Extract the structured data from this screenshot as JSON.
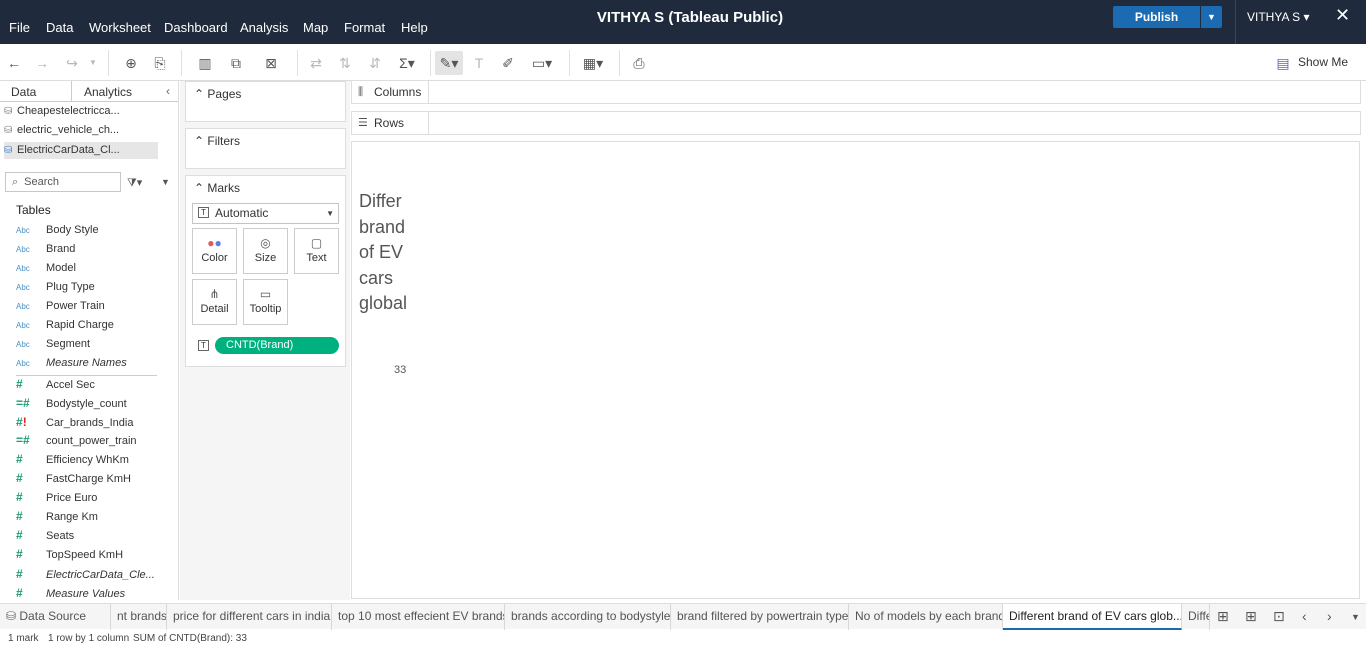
{
  "menubar": {
    "items": [
      "File",
      "Data",
      "Worksheet",
      "Dashboard",
      "Analysis",
      "Map",
      "Format",
      "Help"
    ],
    "title": "VITHYA S (Tableau Public)",
    "publish_label": "Publish",
    "user_label": "VITHYA S ▾",
    "close_glyph": "✕"
  },
  "toolbar": {
    "show_me_label": "Show Me"
  },
  "left_pane": {
    "tab_data": "Data",
    "tab_analytics": "Analytics",
    "data_sources": [
      "Cheapestelectricca...",
      "electric_vehicle_ch...",
      "ElectricCarData_Cl..."
    ],
    "search_placeholder": "Search",
    "tables_label": "Tables",
    "dimensions": [
      {
        "type": "Abc",
        "name": "Body Style"
      },
      {
        "type": "Abc",
        "name": "Brand"
      },
      {
        "type": "Abc",
        "name": "Model"
      },
      {
        "type": "Abc",
        "name": "Plug Type"
      },
      {
        "type": "Abc",
        "name": "Power Train"
      },
      {
        "type": "Abc",
        "name": "Rapid Charge"
      },
      {
        "type": "Abc",
        "name": "Segment"
      },
      {
        "type": "Abc",
        "name": "Measure Names"
      }
    ],
    "measures": [
      {
        "type": "#",
        "name": "Accel Sec"
      },
      {
        "type": "=#",
        "name": "Bodystyle_count"
      },
      {
        "type": "#!",
        "name": "Car_brands_India"
      },
      {
        "type": "=#",
        "name": "count_power_train"
      },
      {
        "type": "#",
        "name": "Efficiency WhKm"
      },
      {
        "type": "#",
        "name": "FastCharge KmH"
      },
      {
        "type": "#",
        "name": "Price Euro"
      },
      {
        "type": "#",
        "name": "Range Km"
      },
      {
        "type": "#",
        "name": "Seats"
      },
      {
        "type": "#",
        "name": "TopSpeed KmH"
      },
      {
        "type": "#",
        "name": "ElectricCarData_Cle..."
      },
      {
        "type": "#",
        "name": "Measure Values"
      }
    ]
  },
  "shelves": {
    "pages_label": "Pages",
    "filters_label": "Filters",
    "marks_label": "Marks",
    "marks_type": "Automatic",
    "marks_buttons": [
      "Color",
      "Size",
      "Text",
      "Detail",
      "Tooltip"
    ],
    "text_pill": "CNTD(Brand)",
    "columns_label": "Columns",
    "rows_label": "Rows"
  },
  "viz": {
    "title_lines": [
      "Differ",
      "brand",
      "of EV",
      "cars",
      "global"
    ],
    "value": "33"
  },
  "sheet_tabs": {
    "data_source": "Data Source",
    "tabs": [
      "nt brands",
      "price for different cars in india",
      "top 10 most effecient EV brands",
      "brands according to bodystyle",
      "brand filtered by powertrain type",
      "No of models by each brand",
      "Different brand of EV cars glob...",
      "Diffe"
    ],
    "active_index": 6
  },
  "status": {
    "marks": "1 mark",
    "dims": "1 row by 1 column",
    "sum": "SUM of CNTD(Brand): 33"
  }
}
